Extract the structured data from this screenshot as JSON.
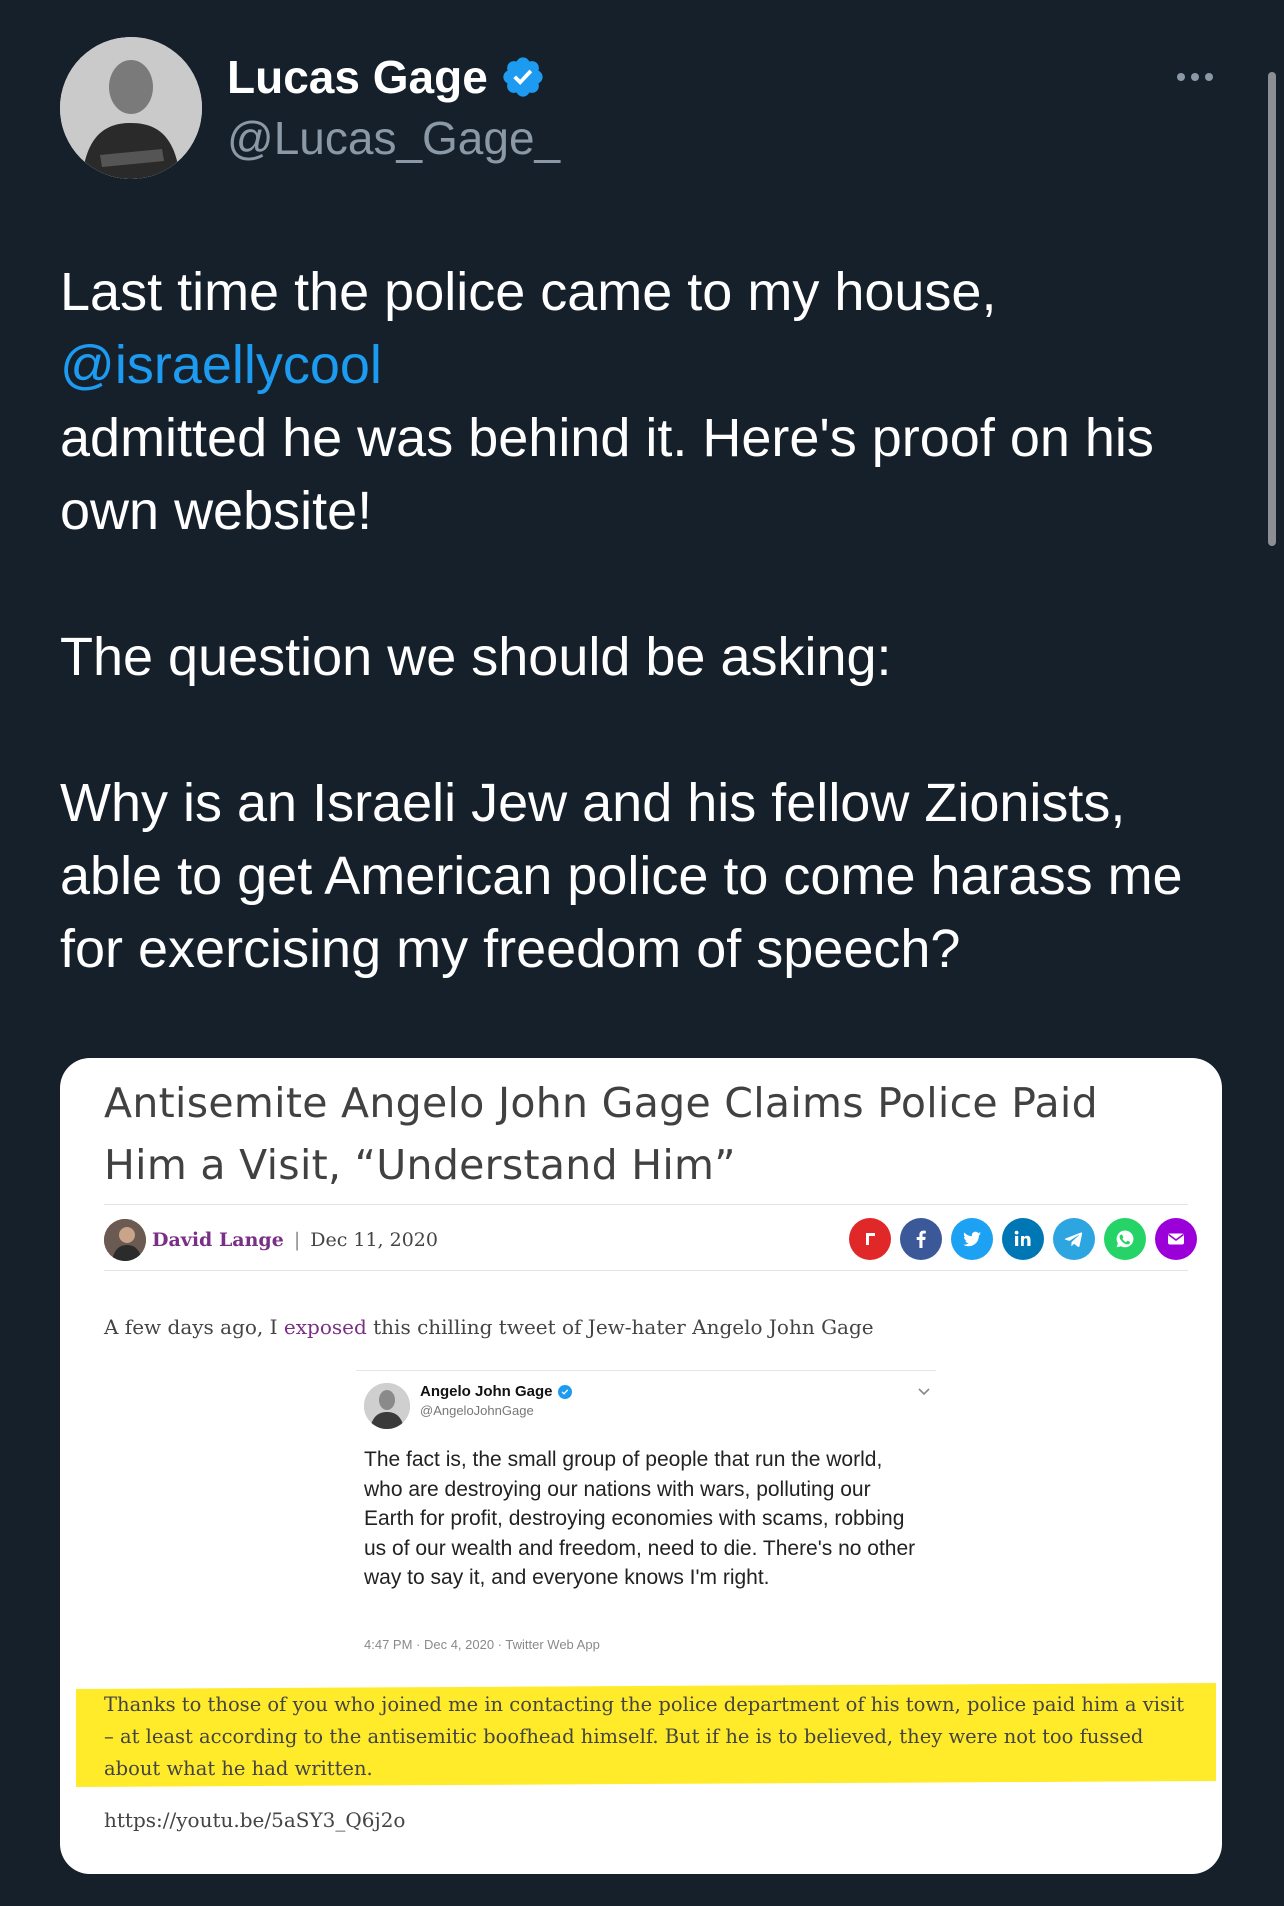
{
  "tweet": {
    "author_name": "Lucas Gage",
    "author_handle": "@Lucas_Gage_",
    "verified_icon": "verified-badge-icon",
    "more_icon": "more-icon",
    "text": {
      "line1": "Last time the police came to my house,",
      "mention": "@israellycool",
      "line2": "admitted he was behind it. Here's proof on his own website!",
      "para2": "The question we should be asking:",
      "para3": "Why is an Israeli Jew and his fellow Zionists, able to get American police to come harass me for exercising my freedom of speech?"
    }
  },
  "card": {
    "article_title": "Antisemite Angelo John Gage Claims Police Paid Him a Visit, “Understand Him”",
    "author": "David Lange",
    "separator": "|",
    "date": "Dec 11, 2020",
    "share_icons": [
      "flipboard-icon",
      "facebook-icon",
      "twitter-icon",
      "linkedin-icon",
      "telegram-icon",
      "whatsapp-icon",
      "email-icon"
    ],
    "intro_prefix": "A few days ago, I ",
    "intro_link": "exposed",
    "intro_suffix": " this chilling tweet of Jew-hater Angelo John Gage",
    "embedded_tweet": {
      "name": "Angelo John Gage",
      "handle": "@AngeloJohnGage",
      "text": "The fact is, the small group of people that run the world, who are destroying our nations with wars, polluting our Earth for profit, destroying economies with scams, robbing us of our wealth and freedom, need to die. There's no other way to say it, and everyone knows I'm right.",
      "meta": "4:47 PM · Dec 4, 2020 · Twitter Web App"
    },
    "highlighted_text": "Thanks to those of you who joined me in contacting the police department of his town, police paid him a visit – at least according to the antisemitic boofhead himself. But if he is to believed, they were not too fussed about what he had written.",
    "url": "https://youtu.be/5aSY3_Q6j2o"
  },
  "colors": {
    "background": "#15202b",
    "mention": "#1d9bf0",
    "verified": "#1d9bf0",
    "highlight": "#ffeb2a",
    "author_link": "#7a2f86"
  }
}
